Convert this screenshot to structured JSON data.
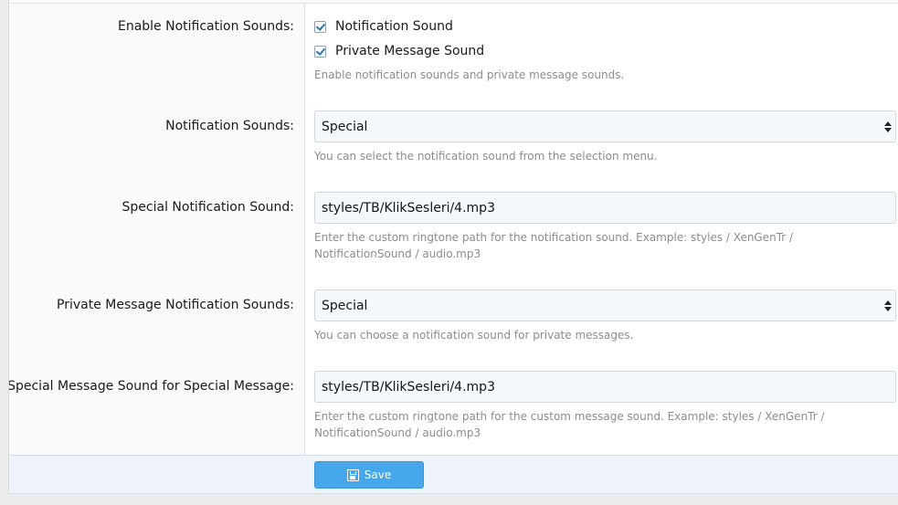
{
  "form": {
    "enable_sounds": {
      "label": "Enable Notification Sounds:",
      "options": [
        {
          "label": "Notification Sound",
          "checked": true
        },
        {
          "label": "Private Message Sound",
          "checked": true
        }
      ],
      "hint": "Enable notification sounds and private message sounds."
    },
    "notification_sounds": {
      "label": "Notification Sounds:",
      "value": "Special",
      "hint": "You can select the notification sound from the selection menu."
    },
    "special_notification_sound": {
      "label": "Special Notification Sound:",
      "value": "styles/TB/KlikSesleri/4.mp3",
      "hint": "Enter the custom ringtone path for the notification sound. Example: styles / XenGenTr / NotificationSound / audio.mp3"
    },
    "pm_notification_sounds": {
      "label": "Private Message Notification Sounds:",
      "value": "Special",
      "hint": "You can choose a notification sound for private messages."
    },
    "special_message_sound": {
      "label": "Special Message Sound for Special Message:",
      "value": "styles/TB/KlikSesleri/4.mp3",
      "hint": "Enter the custom ringtone path for the custom message sound. Example: styles / XenGenTr / NotificationSound / audio.mp3"
    }
  },
  "footer": {
    "save_label": "Save"
  },
  "colors": {
    "accent": "#47a7eb",
    "checkbox_check": "#2577b1",
    "hint_text": "#8c8c8c"
  }
}
